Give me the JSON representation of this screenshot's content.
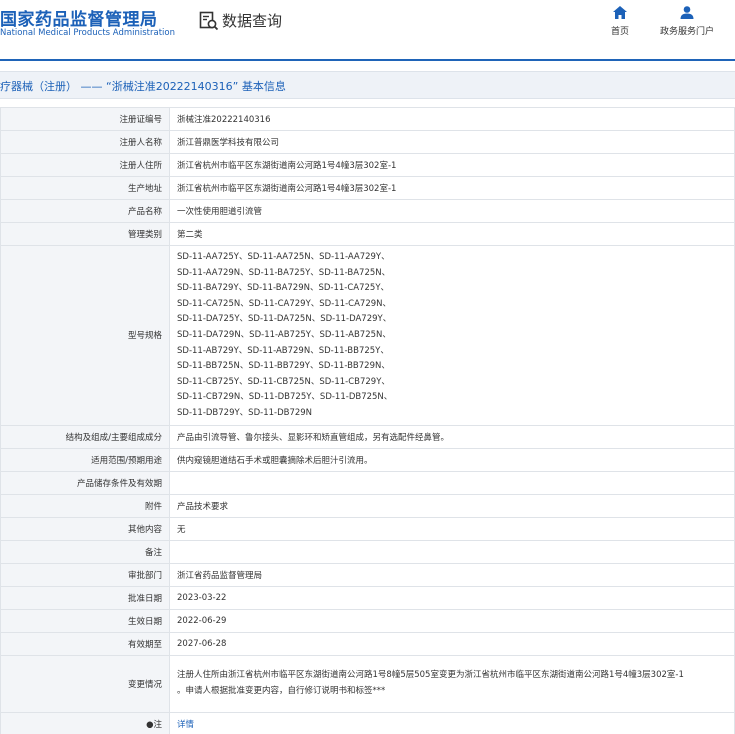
{
  "header": {
    "logo_cn": "国家药品监督管理局",
    "logo_en": "National Medical Products Administration",
    "query_label": "数据查询",
    "nav": [
      {
        "label": "首页",
        "icon": "home-icon"
      },
      {
        "label": "政务服务门户",
        "icon": "user-icon"
      }
    ]
  },
  "title": "疗器械（注册） —— “浙械注准20222140316” 基本信息",
  "colors": {
    "brand": "#1c61b8",
    "label_bg": "#f3f5f8",
    "title_bg": "#eef2f7"
  },
  "rows": {
    "reg_no": {
      "label": "注册证编号",
      "value": "浙械注准20222140316"
    },
    "registrant": {
      "label": "注册人名称",
      "value": "浙江普鼎医学科技有限公司"
    },
    "registrant_addr": {
      "label": "注册人住所",
      "value": "浙江省杭州市临平区东湖街道南公河路1号4幢3层302室-1"
    },
    "prod_addr": {
      "label": "生产地址",
      "value": "浙江省杭州市临平区东湖街道南公河路1号4幢3层302室-1"
    },
    "product_name": {
      "label": "产品名称",
      "value": "一次性使用胆道引流管"
    },
    "mgmt_class": {
      "label": "管理类别",
      "value": "第二类"
    },
    "models": {
      "label": "型号规格",
      "lines": [
        "SD-11-AA725Y、SD-11-AA725N、SD-11-AA729Y、",
        "SD-11-AA729N、SD-11-BA725Y、SD-11-BA725N、",
        "SD-11-BA729Y、SD-11-BA729N、SD-11-CA725Y、",
        "SD-11-CA725N、SD-11-CA729Y、SD-11-CA729N、",
        "SD-11-DA725Y、SD-11-DA725N、SD-11-DA729Y、",
        "SD-11-DA729N、SD-11-AB725Y、SD-11-AB725N、",
        "SD-11-AB729Y、SD-11-AB729N、SD-11-BB725Y、",
        "SD-11-BB725N、SD-11-BB729Y、SD-11-BB729N、",
        "SD-11-CB725Y、SD-11-CB725N、SD-11-CB729Y、",
        "SD-11-CB729N、SD-11-DB725Y、SD-11-DB725N、",
        "SD-11-DB729Y、SD-11-DB729N"
      ]
    },
    "structure": {
      "label": "结构及组成/主要组成成分",
      "value": "产品由引流导管、鲁尔接头、显影环和矫直管组成，另有选配件经鼻管。"
    },
    "scope": {
      "label": "适用范围/预期用途",
      "value": "供内窥镜胆道结石手术或胆囊摘除术后胆汁引流用。"
    },
    "storage": {
      "label": "产品储存条件及有效期",
      "value": ""
    },
    "attachment": {
      "label": "附件",
      "value": "产品技术要求"
    },
    "other": {
      "label": "其他内容",
      "value": "无"
    },
    "remark": {
      "label": "备注",
      "value": ""
    },
    "approval_dept": {
      "label": "审批部门",
      "value": "浙江省药品监督管理局"
    },
    "approval_date": {
      "label": "批准日期",
      "value": "2023-03-22"
    },
    "effective_date": {
      "label": "生效日期",
      "value": "2022-06-29"
    },
    "expiry_date": {
      "label": "有效期至",
      "value": "2027-06-28"
    },
    "changes": {
      "label": "变更情况",
      "line1": "注册人住所由浙江省杭州市临平区东湖街道南公河路1号8幢5层505室变更为浙江省杭州市临平区东湖街道南公河路1号4幢3层302室-1",
      "line2": "。申请人根据批准变更内容，自行修订说明书和标签***"
    },
    "note": {
      "label": "注",
      "link": "详情"
    }
  }
}
